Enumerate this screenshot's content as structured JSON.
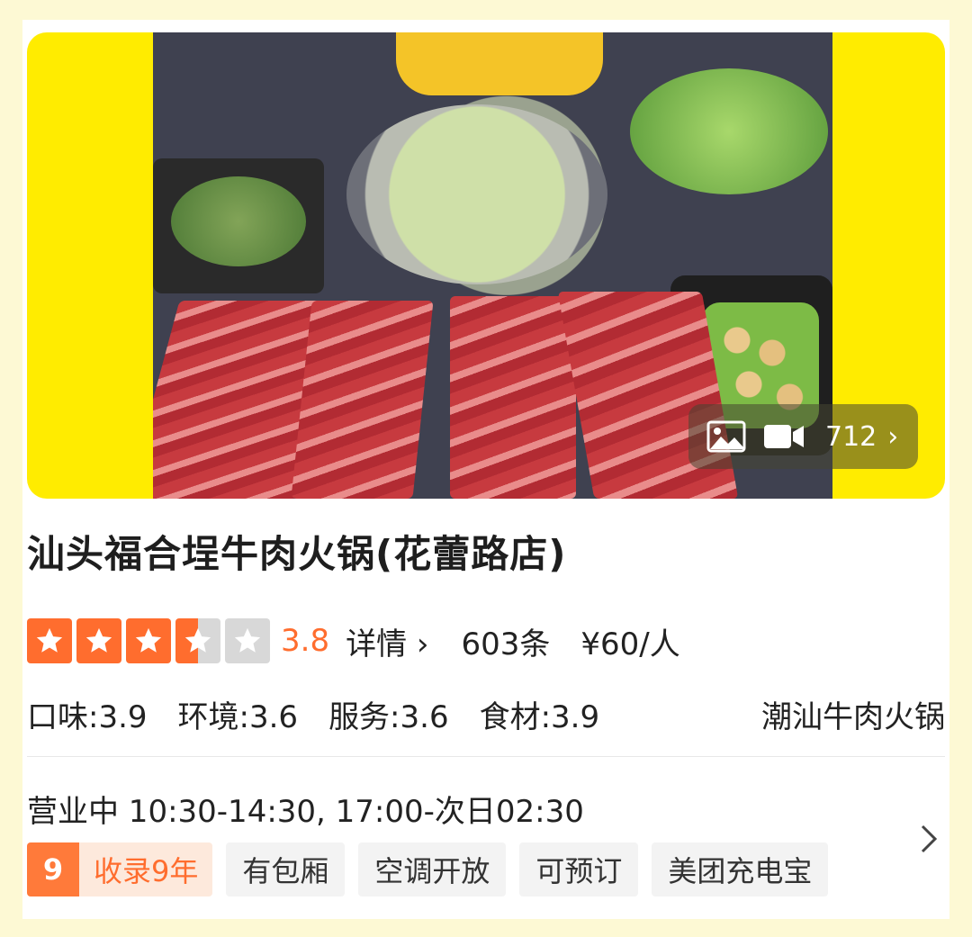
{
  "media": {
    "count": "712",
    "chevron": "›",
    "photo_icon": "image-icon",
    "video_icon": "video-camera-icon"
  },
  "shop": {
    "name": "汕头福合埕牛肉火锅(花蕾路店)"
  },
  "rating": {
    "stars": 3.5,
    "score": "3.8",
    "detail_label": "详情 ›",
    "reviews": "603条",
    "price": "¥60/人"
  },
  "subscores": {
    "taste": "口味:3.9",
    "environment": "环境:3.6",
    "service": "服务:3.6",
    "ingredients": "食材:3.9",
    "category": "潮汕牛肉火锅"
  },
  "hours": "营业中 10:30-14:30, 17:00-次日02:30",
  "tags": {
    "years_num": "9",
    "years_label": "收录9年",
    "private_room": "有包厢",
    "aircon": "空调开放",
    "reservable": "可预订",
    "powerbank": "美团充电宝"
  },
  "colors": {
    "accent": "#ff6d2e",
    "hero_bg": "#ffec00",
    "page_bg": "#fdf9d4"
  }
}
